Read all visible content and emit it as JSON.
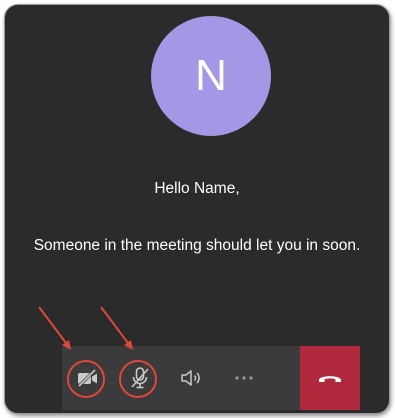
{
  "avatar": {
    "initial": "N",
    "color": "#a596e6"
  },
  "greeting": "Hello Name,",
  "message": "Someone in the meeting should let you in soon.",
  "controls": {
    "camera": {
      "icon": "camera-off-icon",
      "state": "off",
      "highlighted": true
    },
    "microphone": {
      "icon": "mic-off-icon",
      "state": "muted",
      "highlighted": true
    },
    "speaker": {
      "icon": "speaker-icon"
    },
    "more": {
      "icon": "more-options-icon"
    },
    "end_call": {
      "icon": "hang-up-icon",
      "color": "#b0293d"
    }
  },
  "annotation_color": "#e0473b"
}
